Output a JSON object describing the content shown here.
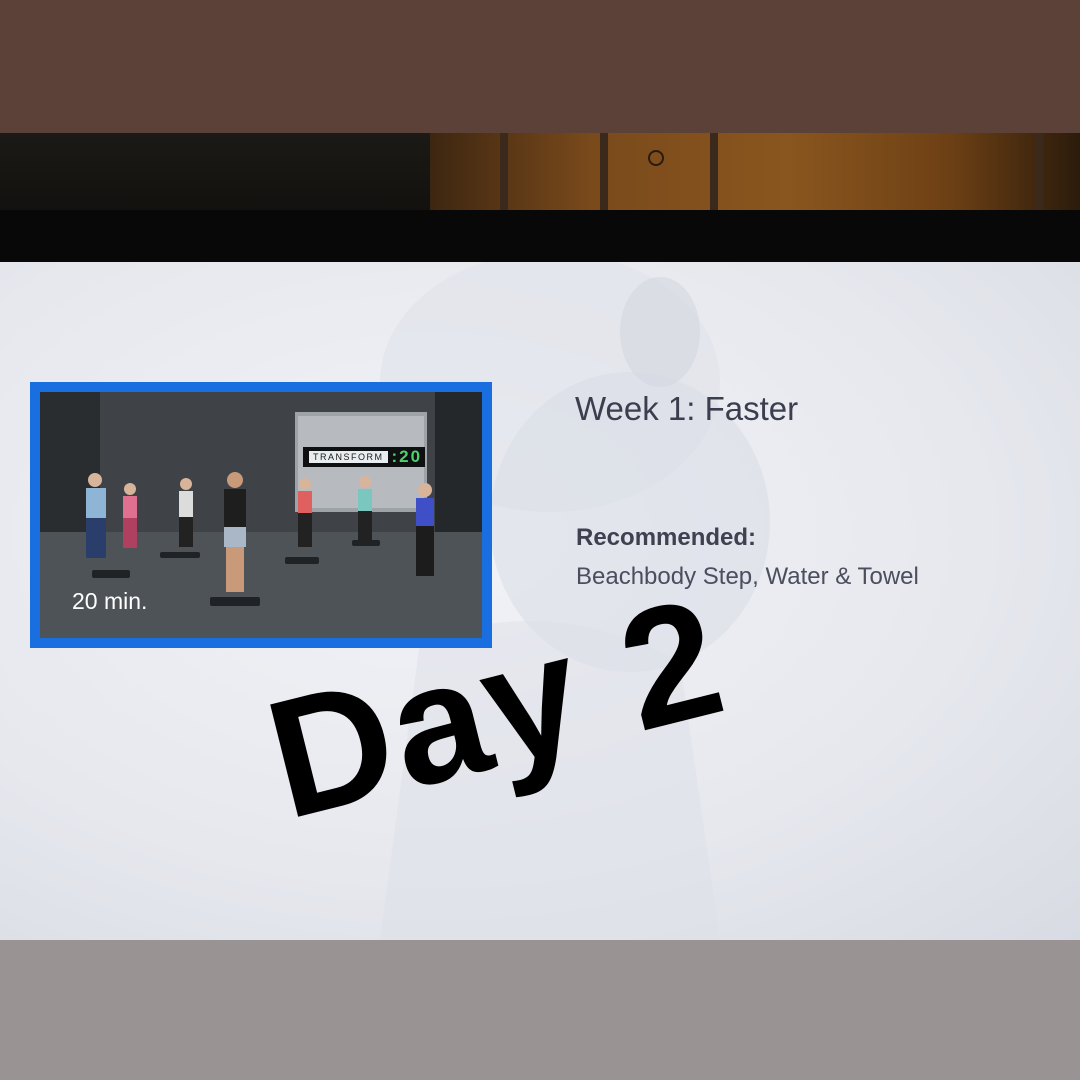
{
  "workout": {
    "title": "Week 1: Faster",
    "duration": "20 min.",
    "recommended_label": "Recommended:",
    "recommended_value": "Beachbody Step, Water & Towel",
    "program_sign": {
      "text": "TRANSFORM",
      "number": ":20"
    }
  },
  "overlay": {
    "caption": "Day 2"
  },
  "colors": {
    "selection_border": "#1a6fe0",
    "screen_background": "#eceef3",
    "title_text": "#3a3e4e"
  }
}
